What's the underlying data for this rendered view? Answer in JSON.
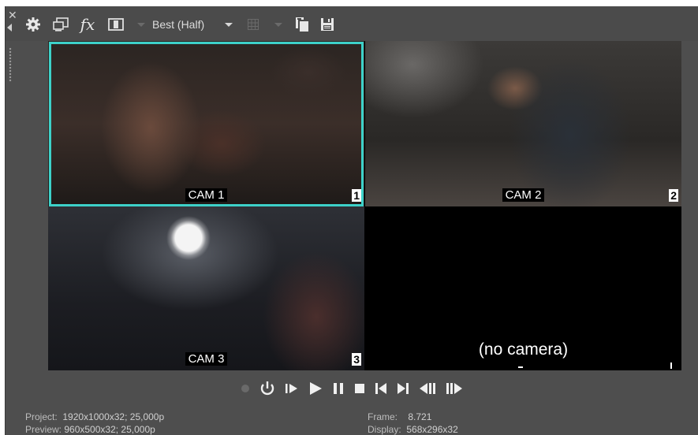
{
  "toolbar": {
    "close_glyph": "✕",
    "icons": [
      "gear-icon",
      "split-screen-icon",
      "fx-icon",
      "overlay-icon",
      "grid-icon",
      "copy-snapshot-icon",
      "save-snapshot-icon"
    ],
    "fx_label": "fx",
    "quality": "Best (Half)"
  },
  "tiles": [
    {
      "label": "CAM 1",
      "number": "1",
      "selected": true
    },
    {
      "label": "CAM 2",
      "number": "2",
      "selected": false
    },
    {
      "label": "CAM 3",
      "number": "3",
      "selected": false
    },
    {
      "label": "(no camera)",
      "number": "",
      "selected": false
    }
  ],
  "transport": [
    "record-icon",
    "loop-icon",
    "play-from-start-icon",
    "play-icon",
    "pause-icon",
    "stop-icon",
    "prev-frame-icon",
    "next-frame-icon",
    "prev-marker-icon",
    "next-marker-icon"
  ],
  "status": {
    "project_key": "Project:",
    "project_val": "1920x1000x32; 25,000p",
    "preview_key": "Preview:",
    "preview_val": "960x500x32; 25,000p",
    "frame_key": "Frame:",
    "frame_val": "8.721",
    "display_key": "Display:",
    "display_val": "568x296x32"
  },
  "colors": {
    "selection": "#3dd1c9",
    "panel": "#4e4e4e"
  }
}
